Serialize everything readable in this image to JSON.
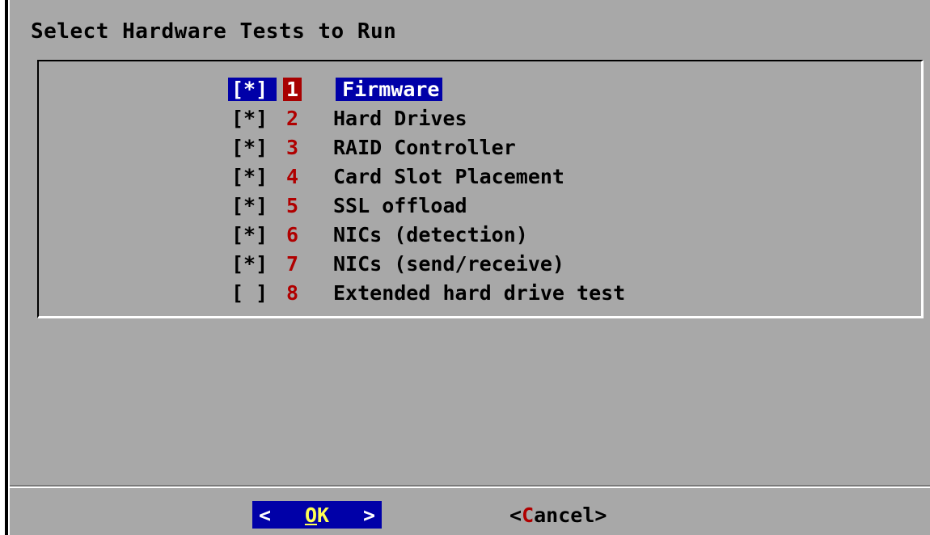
{
  "dialog": {
    "title": "Select Hardware Tests to Run"
  },
  "tests": [
    {
      "check": "[*]",
      "number": "1",
      "label": "Firmware",
      "selected": true
    },
    {
      "check": "[*]",
      "number": "2",
      "label": "Hard Drives",
      "selected": false
    },
    {
      "check": "[*]",
      "number": "3",
      "label": "RAID Controller",
      "selected": false
    },
    {
      "check": "[*]",
      "number": "4",
      "label": "Card Slot Placement",
      "selected": false
    },
    {
      "check": "[*]",
      "number": "5",
      "label": "SSL offload",
      "selected": false
    },
    {
      "check": "[*]",
      "number": "6",
      "label": "NICs (detection)",
      "selected": false
    },
    {
      "check": "[*]",
      "number": "7",
      "label": "NICs (send/receive)",
      "selected": false
    },
    {
      "check": "[ ]",
      "number": "8",
      "label": "Extended hard drive test",
      "selected": false
    }
  ],
  "buttons": {
    "ok": {
      "left_bracket": "<",
      "hotkey": "O",
      "rest": "K",
      "right_bracket": ">"
    },
    "cancel": {
      "open": "<",
      "hotkey": "C",
      "rest": "ancel",
      "close": ">"
    }
  },
  "colors": {
    "dialog_bg": "#a8a8a8",
    "selection_bg": "#0000a8",
    "number_fg": "#b00000",
    "hotkey_fg": "#ffff55"
  }
}
